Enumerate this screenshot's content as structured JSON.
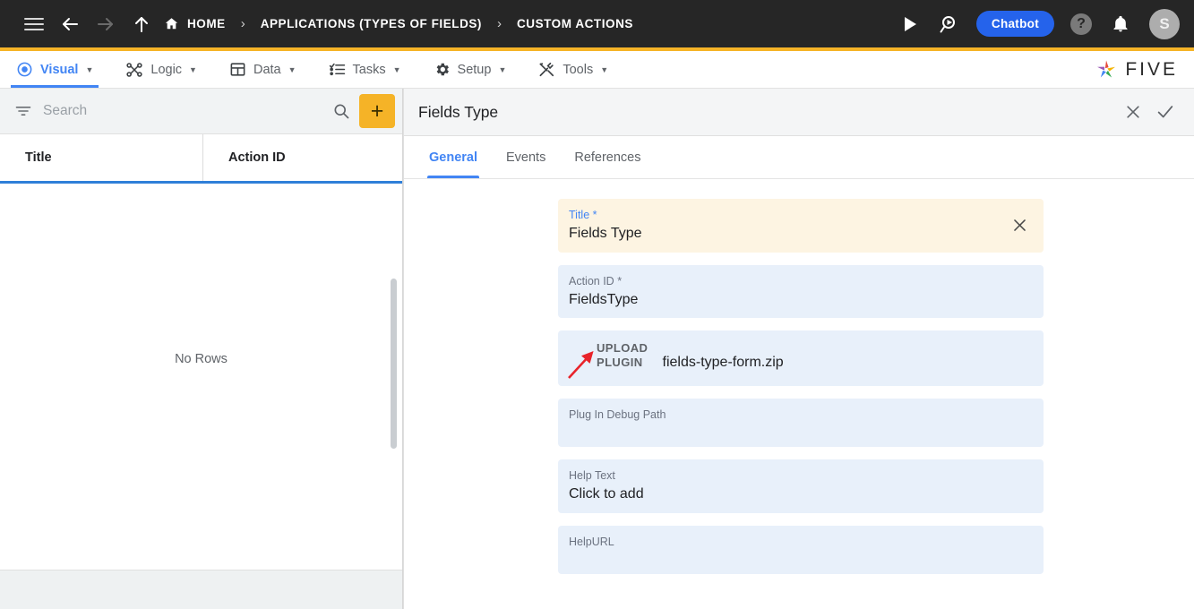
{
  "topbar": {
    "nav_icons": [
      {
        "name": "menu-icon",
        "label": "Menu"
      },
      {
        "name": "back-arrow-icon",
        "label": "Back"
      },
      {
        "name": "forward-arrow-icon",
        "label": "Forward"
      },
      {
        "name": "up-arrow-icon",
        "label": "Up"
      }
    ],
    "breadcrumbs": [
      {
        "label": "HOME",
        "icon": "home-icon"
      },
      {
        "label": "APPLICATIONS (TYPES OF FIELDS)",
        "icon": ""
      },
      {
        "label": "CUSTOM ACTIONS",
        "icon": ""
      }
    ],
    "separator": "›",
    "run_label": "Run",
    "search_label": "Search Everywhere",
    "chatbot_label": "Chatbot",
    "help_label": "?",
    "notifications_label": "Notifications",
    "avatar_initial": "S",
    "background": "#262626",
    "accent_color": "#f5b327",
    "chatbot_color": "#2563eb"
  },
  "menubar": {
    "items": [
      {
        "label": "Visual",
        "icon": "eye-icon",
        "caret": "▼",
        "active": true
      },
      {
        "label": "Logic",
        "icon": "logic-nodes-icon",
        "caret": "▼",
        "active": false
      },
      {
        "label": "Data",
        "icon": "table-grid-icon",
        "caret": "▼",
        "active": false
      },
      {
        "label": "Tasks",
        "icon": "checklist-icon",
        "caret": "▼",
        "active": false
      },
      {
        "label": "Setup",
        "icon": "gear-icon",
        "caret": "▼",
        "active": false
      },
      {
        "label": "Tools",
        "icon": "tools-wrench-icon",
        "caret": "▼",
        "active": false
      }
    ],
    "brand": "FIVE",
    "active_color": "#4285f4"
  },
  "list_panel": {
    "search": {
      "value": "",
      "placeholder": "Search"
    },
    "filter_icon": "filter-icon",
    "search_icon": "search-icon",
    "add_label": "+",
    "columns": [
      "Title",
      "Action ID"
    ],
    "rows": [],
    "empty_message": "No Rows",
    "add_color": "#f5b327",
    "header_underline_color": "#2f7fd8"
  },
  "detail_panel": {
    "title": "Fields Type",
    "close_label": "✕",
    "confirm_label": "✓",
    "tabs": [
      {
        "label": "General",
        "active": true
      },
      {
        "label": "Events",
        "active": false
      },
      {
        "label": "References",
        "active": false
      }
    ],
    "fields": [
      {
        "key": "title",
        "label": "Title",
        "required": true,
        "value": "Fields Type",
        "focused": true,
        "clearable": true,
        "type": "text"
      },
      {
        "key": "action_id",
        "label": "Action ID",
        "required": true,
        "value": "FieldsType",
        "focused": false,
        "clearable": false,
        "type": "text"
      },
      {
        "key": "upload_plugin",
        "label_line1": "UPLOAD",
        "label_line2": "PLUGIN",
        "value": "fields-type-form.zip",
        "focused": false,
        "type": "upload",
        "annotation": {
          "shape": "arrow",
          "color": "#e8232a",
          "direction": "up-right"
        }
      },
      {
        "key": "plugin_debug_path",
        "label": "Plug In Debug Path",
        "required": false,
        "value": "",
        "focused": false,
        "clearable": false,
        "type": "text"
      },
      {
        "key": "help_text",
        "label": "Help Text",
        "required": false,
        "value": "Click to add",
        "focused": false,
        "clearable": false,
        "type": "text"
      },
      {
        "key": "help_url",
        "label": "HelpURL",
        "required": false,
        "value": "",
        "focused": false,
        "clearable": false,
        "type": "text"
      }
    ],
    "field_bg": "#e8f0fa",
    "focused_field_bg": "#fdf4e2"
  }
}
